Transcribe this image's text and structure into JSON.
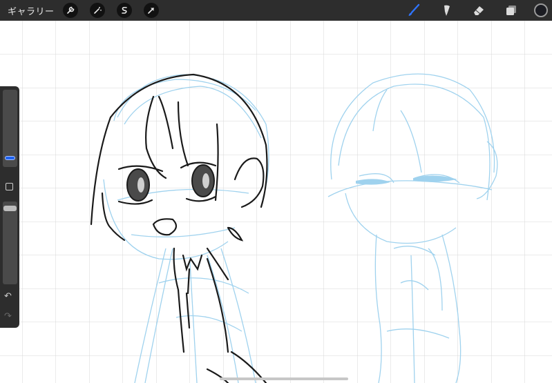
{
  "app": {
    "gallery_label": "ギャラリー"
  },
  "toolbar_left": {
    "items": [
      {
        "icon": "wrench-icon"
      },
      {
        "icon": "magic-wand-icon"
      },
      {
        "icon": "selection-icon"
      },
      {
        "icon": "transform-arrow-icon"
      }
    ]
  },
  "toolbar_right": {
    "items": [
      {
        "icon": "brush-icon",
        "active": true
      },
      {
        "icon": "smudge-icon"
      },
      {
        "icon": "eraser-icon"
      },
      {
        "icon": "layers-icon"
      }
    ],
    "current_color": "#1b1c22"
  },
  "colors": {
    "toolbar_bg": "#2d2d2d",
    "accent_blue": "#1e62f0",
    "sketch_blue": "#9fd2ee",
    "grid": "#d7d7d7",
    "ink": "#1a1a1a"
  },
  "sidebar": {
    "icons": [
      "undo-icon",
      "redo-icon",
      "modify-square-icon"
    ]
  }
}
